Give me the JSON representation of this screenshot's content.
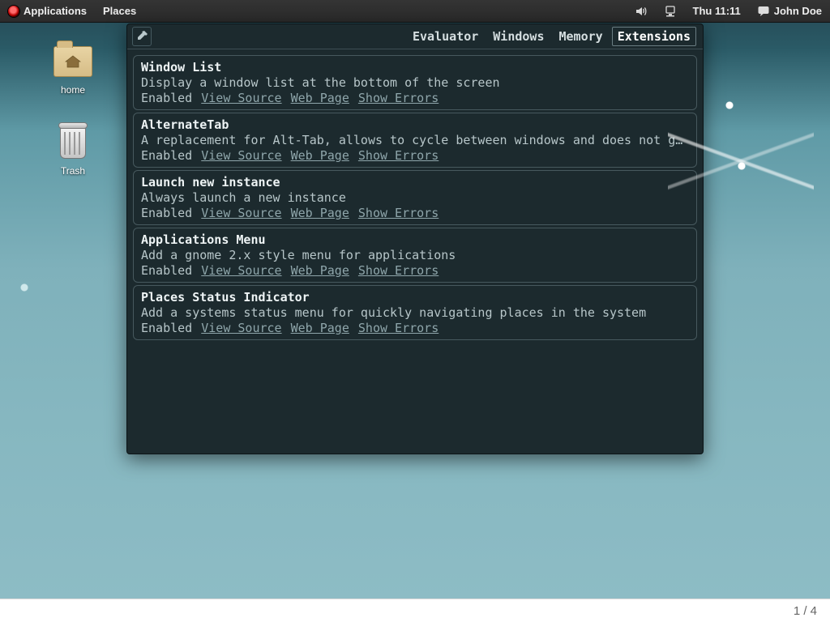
{
  "topbar": {
    "applications": "Applications",
    "places": "Places",
    "clock": "Thu 11:11",
    "user": "John Doe"
  },
  "desktop_icons": {
    "home": "home",
    "trash": "Trash"
  },
  "lg": {
    "tabs": {
      "evaluator": "Evaluator",
      "windows": "Windows",
      "memory": "Memory",
      "extensions": "Extensions"
    }
  },
  "extensions": [
    {
      "name": "Window List",
      "desc": "Display a window list at the bottom of the screen",
      "status": "Enabled",
      "view_source": "View Source",
      "web_page": "Web Page",
      "show_errors": "Show Errors"
    },
    {
      "name": "AlternateTab",
      "desc": "A replacement for Alt-Tab, allows to cycle between windows and does not g…",
      "status": "Enabled",
      "view_source": "View Source",
      "web_page": "Web Page",
      "show_errors": "Show Errors"
    },
    {
      "name": "Launch new instance",
      "desc": "Always launch a new instance",
      "status": "Enabled",
      "view_source": "View Source",
      "web_page": "Web Page",
      "show_errors": "Show Errors"
    },
    {
      "name": "Applications Menu",
      "desc": "Add a gnome 2.x style menu for applications",
      "status": "Enabled",
      "view_source": "View Source",
      "web_page": "Web Page",
      "show_errors": "Show Errors"
    },
    {
      "name": "Places Status Indicator",
      "desc": "Add a systems status menu for quickly navigating places in the system",
      "status": "Enabled",
      "view_source": "View Source",
      "web_page": "Web Page",
      "show_errors": "Show Errors"
    }
  ],
  "footer": {
    "pager": "1 / 4"
  }
}
